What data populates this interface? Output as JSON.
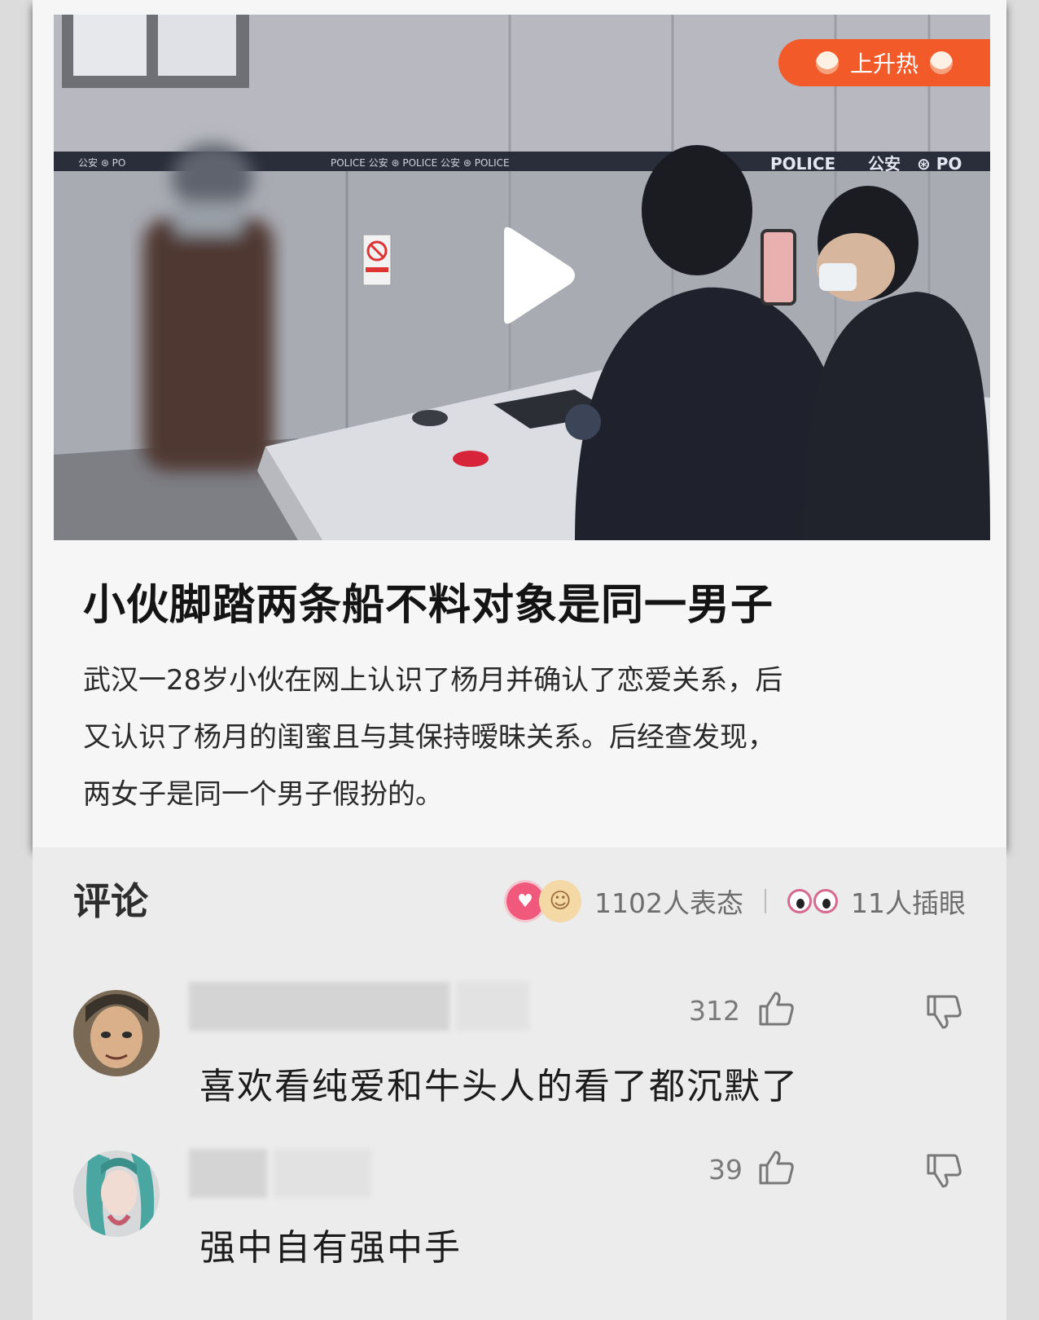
{
  "news": {
    "badge_label": "上升热",
    "title": "小伙脚踏两条船不料对象是同一男子",
    "summary_lines": [
      "武汉一28岁小伙在网上认识了杨月并确认了恋爱关系，后",
      "又认识了杨月的闺蜜且与其保持暧昧关系。后经查发现，",
      "两女子是同一个男子假扮的。"
    ],
    "video_signage": {
      "police": "POLICE",
      "gongan": "公安"
    }
  },
  "comments": {
    "heading": "评论",
    "reactions_text": "1102人表态",
    "peek_text": "11人插眼",
    "items": [
      {
        "likes": "312",
        "text": "喜欢看纯爱和牛头人的看了都沉默了"
      },
      {
        "likes": "39",
        "text": "强中自有强中手"
      }
    ]
  }
}
